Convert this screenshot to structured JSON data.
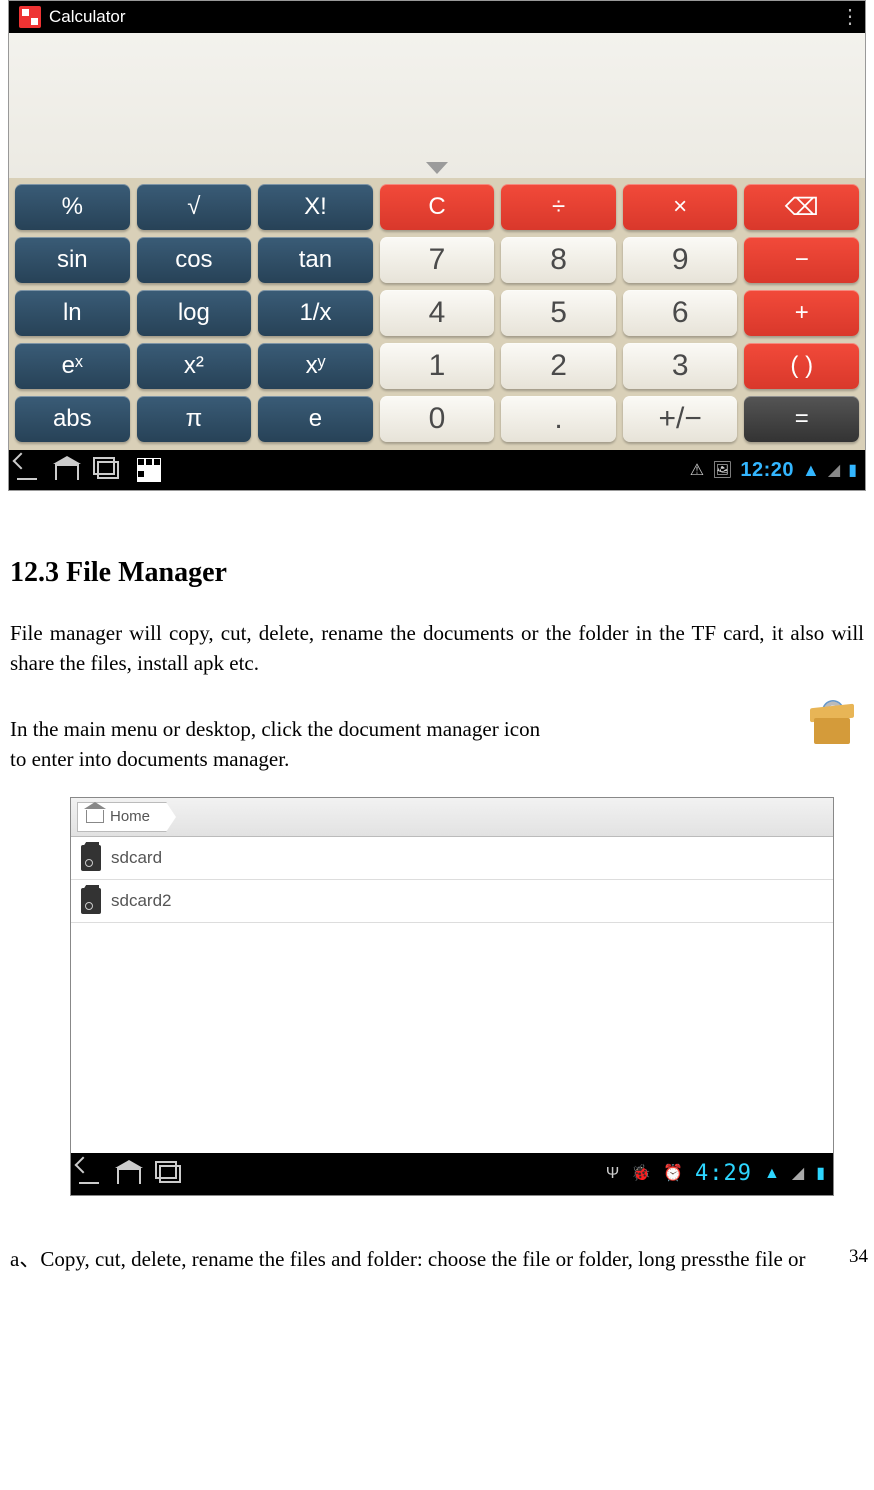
{
  "calculator": {
    "title": "Calculator",
    "rows": [
      [
        "%",
        "√",
        "X!",
        "C",
        "÷",
        "×",
        "⌫"
      ],
      [
        "sin",
        "cos",
        "tan",
        "7",
        "8",
        "9",
        "−"
      ],
      [
        "ln",
        "log",
        "1/x",
        "4",
        "5",
        "6",
        "+"
      ],
      [
        "eˣ",
        "x²",
        "xʸ",
        "1",
        "2",
        "3",
        "( )"
      ],
      [
        "abs",
        "π",
        "e",
        "0",
        ".",
        "+/−",
        "="
      ]
    ],
    "status_time": "12:20"
  },
  "section": {
    "heading": "12.3 File Manager",
    "p1": "File manager will copy, cut, delete, rename the documents or the folder in the TF card, it also will share the files, install apk etc.",
    "p2a": "In the main menu or desktop, click the document manager icon ",
    "p2b": " to enter into documents manager.",
    "p3": "a、Copy, cut, delete, rename the files and folder: choose the file or folder, long pressthe file or"
  },
  "filemanager": {
    "breadcrumb": "Home",
    "items": [
      "sdcard",
      "sdcard2"
    ],
    "status_time": "4:29"
  },
  "page_number": "34"
}
